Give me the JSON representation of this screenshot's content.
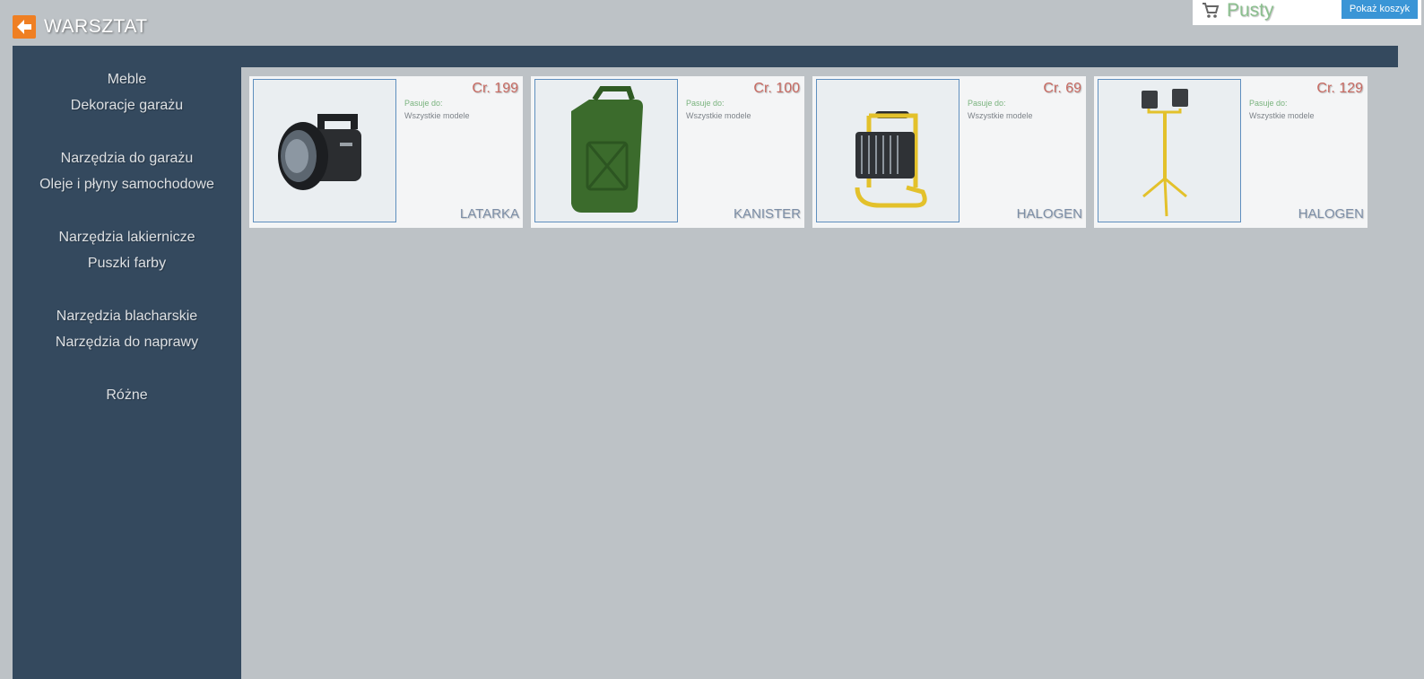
{
  "header": {
    "title": "WARSZTAT"
  },
  "cart": {
    "status": "Pusty",
    "button_label": "Pokaż koszyk"
  },
  "sidebar": {
    "items": [
      {
        "label": "Meble"
      },
      {
        "label": "Dekoracje garażu"
      },
      {
        "label": "Narzędzia do garażu"
      },
      {
        "label": "Oleje i płyny samochodowe"
      },
      {
        "label": "Narzędzia lakiernicze"
      },
      {
        "label": "Puszki farby"
      },
      {
        "label": "Narzędzia blacharskie"
      },
      {
        "label": "Narzędzia do naprawy"
      },
      {
        "label": "Różne"
      }
    ]
  },
  "products": [
    {
      "price": "Cr. 199",
      "fits_label": "Pasuje do:",
      "fits_value": "Wszystkie modele",
      "name": "LATARKA",
      "icon": "flashlight-icon"
    },
    {
      "price": "Cr. 100",
      "fits_label": "Pasuje do:",
      "fits_value": "Wszystkie modele",
      "name": "KANISTER",
      "icon": "jerrycan-icon"
    },
    {
      "price": "Cr. 69",
      "fits_label": "Pasuje do:",
      "fits_value": "Wszystkie modele",
      "name": "HALOGEN",
      "icon": "halogen-lamp-icon"
    },
    {
      "price": "Cr. 129",
      "fits_label": "Pasuje do:",
      "fits_value": "Wszystkie modele",
      "name": "HALOGEN",
      "icon": "tripod-halogen-icon"
    }
  ],
  "colors": {
    "background": "#bdc2c6",
    "sidebar": "#34495e",
    "accent_orange": "#ef7f23",
    "button_blue": "#3a95d6",
    "price_red": "#c76a62",
    "fits_green": "#7ab37e"
  }
}
